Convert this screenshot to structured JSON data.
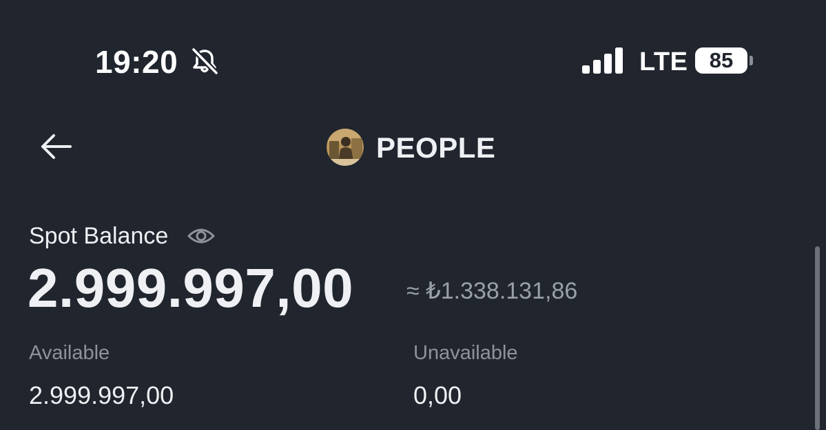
{
  "status_bar": {
    "time": "19:20",
    "mute_icon": "bell-slash-icon",
    "signal_icon": "cellular-signal-icon",
    "network": "LTE",
    "battery_level": "85"
  },
  "header": {
    "back_icon": "arrow-left-icon",
    "token_avatar": "token-logo",
    "title": "PEOPLE"
  },
  "balance": {
    "label": "Spot Balance",
    "visibility_icon": "eye-icon",
    "amount": "2.999.997,00",
    "fiat_equivalent": "≈ ₺1.338.131,86"
  },
  "breakdown": {
    "available_label": "Available",
    "available_value": "2.999.997,00",
    "unavailable_label": "Unavailable",
    "unavailable_value": "0,00"
  },
  "colors": {
    "background": "#21252e",
    "primary_text": "#eef0f3",
    "secondary_text": "#8d929c"
  }
}
